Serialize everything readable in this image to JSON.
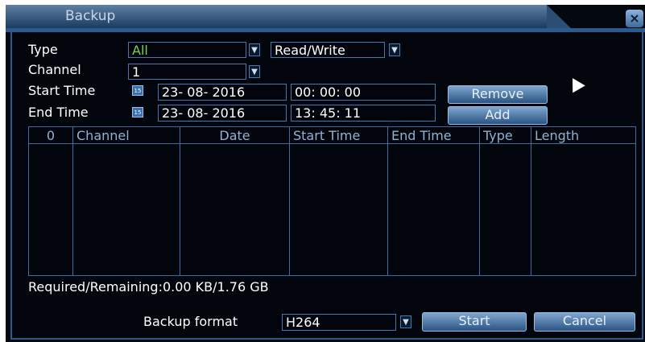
{
  "window": {
    "title": "Backup",
    "close_glyph": "×"
  },
  "form": {
    "type_label": "Type",
    "type_value": "All",
    "mode_value": "Read/Write",
    "channel_label": "Channel",
    "channel_value": "1",
    "start_label": "Start Time",
    "start_date": "23- 08- 2016",
    "start_time": "00: 00: 00",
    "end_label": "End Time",
    "end_date": "23- 08- 2016",
    "end_time": "13: 45: 11",
    "calendar_glyph": "15"
  },
  "buttons": {
    "remove": "Remove",
    "add": "Add",
    "start": "Start",
    "cancel": "Cancel"
  },
  "table": {
    "columns": [
      "0",
      "Channel",
      "Date",
      "Start Time",
      "End Time",
      "Type",
      "Length"
    ]
  },
  "status": {
    "required_remaining": "Required/Remaining:0.00 KB/1.76 GB"
  },
  "backup": {
    "format_label": "Backup format",
    "format_value": "H264"
  },
  "colors": {
    "accent": "#2b5a8e",
    "background": "#04080f",
    "type_value": "#7cd14a"
  }
}
